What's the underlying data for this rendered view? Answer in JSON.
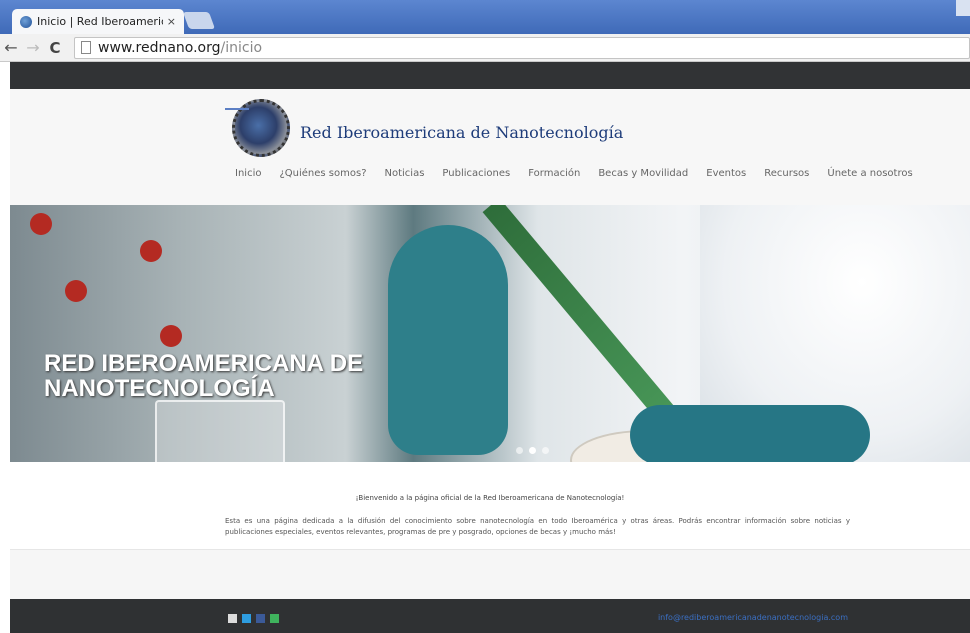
{
  "browser": {
    "tab_title": "Inicio | Red Iberoamerican",
    "tab_close": "×",
    "url_host": "www.rednano.org",
    "url_path": "/inicio",
    "back": "←",
    "forward": "→",
    "reload": "C"
  },
  "header": {
    "site_title": "Red Iberoamericana de Nanotecnología",
    "nav": [
      "Inicio",
      "¿Quiénes somos?",
      "Noticias",
      "Publicaciones",
      "Formación",
      "Becas y Movilidad",
      "Eventos",
      "Recursos",
      "Únete a nosotros"
    ]
  },
  "hero": {
    "title": "RED IBEROAMERICANA DE NANOTECNOLOGÍA",
    "slides": 3,
    "active_slide": 2
  },
  "content": {
    "welcome": "¡Bienvenido a la página oficial de la Red Iberoamericana de Nanotecnología!",
    "description": "Esta es una página dedicada a la difusión del conocimiento sobre nanotecnología en todo Iberoamérica y otras áreas. Podrás encontrar información sobre noticias y publicaciones especiales, eventos relevantes, programas de pre y posgrado, opciones de becas y ¡mucho más!"
  },
  "footer": {
    "email": "info@rediberoamericanadenanotecnologia.com",
    "social_icons": [
      "mail-icon",
      "twitter-icon",
      "facebook-icon",
      "share-icon"
    ]
  }
}
